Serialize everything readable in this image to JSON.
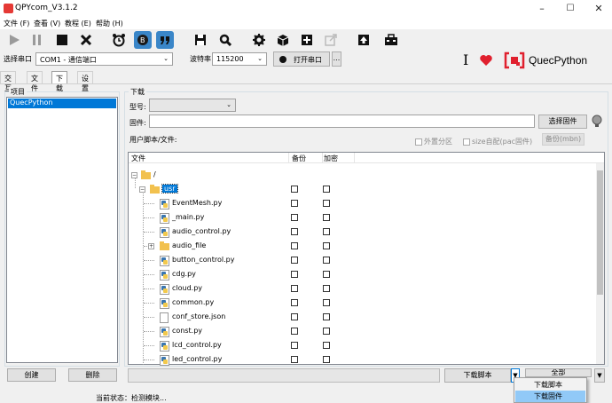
{
  "window": {
    "title": "QPYcom_V3.1.2",
    "controls": [
      "–",
      "☐",
      "✕"
    ]
  },
  "menu": [
    {
      "label": "文件 (F)"
    },
    {
      "label": "查看 (V)"
    },
    {
      "label": "教程 (E)"
    },
    {
      "label": "帮助 (H)"
    }
  ],
  "portbar": {
    "port_label": "选择串口",
    "port_value": "COM1 - 通信端口",
    "baud_label": "波特率",
    "baud_value": "115200",
    "open_button": "打开串口",
    "more_button": "...",
    "brand": "QuecPython",
    "cursor_glyph": "I",
    "heart_color": "#e0202e"
  },
  "tabs": [
    {
      "label": "交互",
      "active": false
    },
    {
      "label": "文件",
      "active": false
    },
    {
      "label": "下载",
      "active": true
    },
    {
      "label": "设置",
      "active": false
    }
  ],
  "left": {
    "group_title": "项目",
    "items": [
      "QuecPython"
    ],
    "create_button": "创建",
    "delete_button": "删除"
  },
  "download": {
    "group_title": "下载",
    "model_label": "型号:",
    "model_value": "",
    "firmware_label": "固件:",
    "firmware_value": "",
    "select_fw_button": "选择固件",
    "user_files_label": "用户脚本/文件:",
    "external_partition": "外置分区",
    "size_auto": "size自配(pac固件)",
    "backup_button": "备份(mbn)",
    "columns": [
      "文件",
      "备份",
      "加密"
    ],
    "tree": [
      {
        "name": "/",
        "level": 0,
        "kind": "folder",
        "expander": "⊟",
        "checks": false
      },
      {
        "name": "usr",
        "level": 1,
        "kind": "folder-selected",
        "expander": "⊟",
        "checks": true
      },
      {
        "name": "EventMesh.py",
        "level": 2,
        "kind": "py",
        "checks": true
      },
      {
        "name": "_main.py",
        "level": 2,
        "kind": "py",
        "checks": true
      },
      {
        "name": "audio_control.py",
        "level": 2,
        "kind": "py",
        "checks": true
      },
      {
        "name": "audio_file",
        "level": 2,
        "kind": "folder",
        "expander": "⊞",
        "checks": true
      },
      {
        "name": "button_control.py",
        "level": 2,
        "kind": "py",
        "checks": true
      },
      {
        "name": "cdg.py",
        "level": 2,
        "kind": "py",
        "checks": true
      },
      {
        "name": "cloud.py",
        "level": 2,
        "kind": "py",
        "checks": true
      },
      {
        "name": "common.py",
        "level": 2,
        "kind": "py",
        "checks": true
      },
      {
        "name": "conf_store.json",
        "level": 2,
        "kind": "file",
        "checks": true
      },
      {
        "name": "const.py",
        "level": 2,
        "kind": "py",
        "checks": true
      },
      {
        "name": "lcd_control.py",
        "level": 2,
        "kind": "py",
        "checks": true
      },
      {
        "name": "led_control.py",
        "level": 2,
        "kind": "py",
        "checks": true
      }
    ],
    "download_script_button": "下载脚本",
    "all_button": "全部",
    "dropdown_items": [
      "下载脚本",
      "下载固件"
    ],
    "dropdown_highlighted": "下载固件"
  },
  "status": {
    "text": "当前状态：检测模块..."
  },
  "colors": {
    "selection": "#0078d7",
    "menu_highlight": "#91c9f7",
    "brand_red": "#e0202e"
  }
}
